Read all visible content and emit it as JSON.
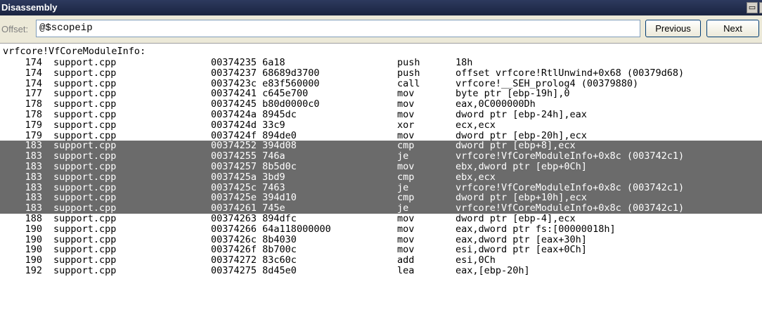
{
  "window": {
    "title": "Disassembly",
    "float_icon": "window-restore-icon",
    "close_icon": "close-icon"
  },
  "toolbar": {
    "offset_label": "Offset:",
    "offset_value": "@$scopeip",
    "previous_label": "Previous",
    "next_label": "Next"
  },
  "listing": {
    "function_header": "vrfcore!VfCoreModuleInfo:",
    "highlight_color": "#6b6b6b",
    "rows": [
      {
        "line": "174",
        "file": "support.cpp",
        "address": "00374235",
        "bytes": "6a18",
        "op": "push",
        "args": "18h",
        "selected": false
      },
      {
        "line": "174",
        "file": "support.cpp",
        "address": "00374237",
        "bytes": "68689d3700",
        "op": "push",
        "args": "offset vrfcore!RtlUnwind+0x68 (00379d68)",
        "selected": false
      },
      {
        "line": "174",
        "file": "support.cpp",
        "address": "0037423c",
        "bytes": "e83f560000",
        "op": "call",
        "args": "vrfcore!__SEH_prolog4 (00379880)",
        "selected": false
      },
      {
        "line": "177",
        "file": "support.cpp",
        "address": "00374241",
        "bytes": "c645e700",
        "op": "mov",
        "args": "byte ptr [ebp-19h],0",
        "selected": false
      },
      {
        "line": "178",
        "file": "support.cpp",
        "address": "00374245",
        "bytes": "b80d0000c0",
        "op": "mov",
        "args": "eax,0C000000Dh",
        "selected": false
      },
      {
        "line": "178",
        "file": "support.cpp",
        "address": "0037424a",
        "bytes": "8945dc",
        "op": "mov",
        "args": "dword ptr [ebp-24h],eax",
        "selected": false
      },
      {
        "line": "179",
        "file": "support.cpp",
        "address": "0037424d",
        "bytes": "33c9",
        "op": "xor",
        "args": "ecx,ecx",
        "selected": false
      },
      {
        "line": "179",
        "file": "support.cpp",
        "address": "0037424f",
        "bytes": "894de0",
        "op": "mov",
        "args": "dword ptr [ebp-20h],ecx",
        "selected": false
      },
      {
        "line": "183",
        "file": "support.cpp",
        "address": "00374252",
        "bytes": "394d08",
        "op": "cmp",
        "args": "dword ptr [ebp+8],ecx",
        "selected": true
      },
      {
        "line": "183",
        "file": "support.cpp",
        "address": "00374255",
        "bytes": "746a",
        "op": "je",
        "args": "vrfcore!VfCoreModuleInfo+0x8c (003742c1)",
        "selected": true
      },
      {
        "line": "183",
        "file": "support.cpp",
        "address": "00374257",
        "bytes": "8b5d0c",
        "op": "mov",
        "args": "ebx,dword ptr [ebp+0Ch]",
        "selected": true
      },
      {
        "line": "183",
        "file": "support.cpp",
        "address": "0037425a",
        "bytes": "3bd9",
        "op": "cmp",
        "args": "ebx,ecx",
        "selected": true
      },
      {
        "line": "183",
        "file": "support.cpp",
        "address": "0037425c",
        "bytes": "7463",
        "op": "je",
        "args": "vrfcore!VfCoreModuleInfo+0x8c (003742c1)",
        "selected": true
      },
      {
        "line": "183",
        "file": "support.cpp",
        "address": "0037425e",
        "bytes": "394d10",
        "op": "cmp",
        "args": "dword ptr [ebp+10h],ecx",
        "selected": true
      },
      {
        "line": "183",
        "file": "support.cpp",
        "address": "00374261",
        "bytes": "745e",
        "op": "je",
        "args": "vrfcore!VfCoreModuleInfo+0x8c (003742c1)",
        "selected": true
      },
      {
        "line": "188",
        "file": "support.cpp",
        "address": "00374263",
        "bytes": "894dfc",
        "op": "mov",
        "args": "dword ptr [ebp-4],ecx",
        "selected": false
      },
      {
        "line": "190",
        "file": "support.cpp",
        "address": "00374266",
        "bytes": "64a118000000",
        "op": "mov",
        "args": "eax,dword ptr fs:[00000018h]",
        "selected": false
      },
      {
        "line": "190",
        "file": "support.cpp",
        "address": "0037426c",
        "bytes": "8b4030",
        "op": "mov",
        "args": "eax,dword ptr [eax+30h]",
        "selected": false
      },
      {
        "line": "190",
        "file": "support.cpp",
        "address": "0037426f",
        "bytes": "8b700c",
        "op": "mov",
        "args": "esi,dword ptr [eax+0Ch]",
        "selected": false
      },
      {
        "line": "190",
        "file": "support.cpp",
        "address": "00374272",
        "bytes": "83c60c",
        "op": "add",
        "args": "esi,0Ch",
        "selected": false
      },
      {
        "line": "192",
        "file": "support.cpp",
        "address": "00374275",
        "bytes": "8d45e0",
        "op": "lea",
        "args": "eax,[ebp-20h]",
        "selected": false
      }
    ]
  }
}
